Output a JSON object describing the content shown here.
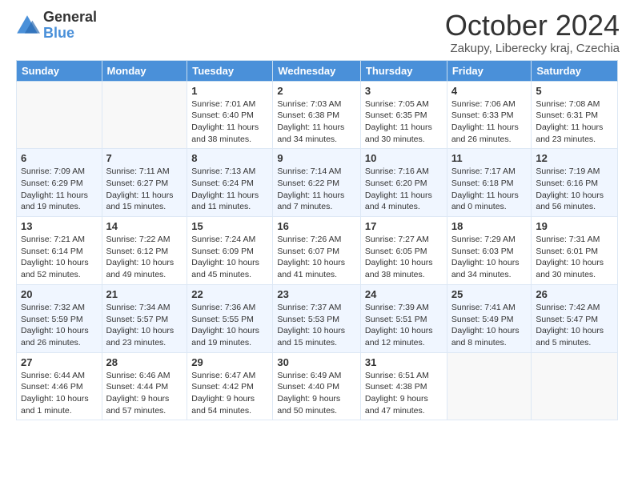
{
  "logo": {
    "general": "General",
    "blue": "Blue"
  },
  "title": "October 2024",
  "location": "Zakupy, Liberecky kraj, Czechia",
  "weekdays": [
    "Sunday",
    "Monday",
    "Tuesday",
    "Wednesday",
    "Thursday",
    "Friday",
    "Saturday"
  ],
  "weeks": [
    [
      {
        "day": "",
        "info": ""
      },
      {
        "day": "",
        "info": ""
      },
      {
        "day": "1",
        "info": "Sunrise: 7:01 AM\nSunset: 6:40 PM\nDaylight: 11 hours and 38 minutes."
      },
      {
        "day": "2",
        "info": "Sunrise: 7:03 AM\nSunset: 6:38 PM\nDaylight: 11 hours and 34 minutes."
      },
      {
        "day": "3",
        "info": "Sunrise: 7:05 AM\nSunset: 6:35 PM\nDaylight: 11 hours and 30 minutes."
      },
      {
        "day": "4",
        "info": "Sunrise: 7:06 AM\nSunset: 6:33 PM\nDaylight: 11 hours and 26 minutes."
      },
      {
        "day": "5",
        "info": "Sunrise: 7:08 AM\nSunset: 6:31 PM\nDaylight: 11 hours and 23 minutes."
      }
    ],
    [
      {
        "day": "6",
        "info": "Sunrise: 7:09 AM\nSunset: 6:29 PM\nDaylight: 11 hours and 19 minutes."
      },
      {
        "day": "7",
        "info": "Sunrise: 7:11 AM\nSunset: 6:27 PM\nDaylight: 11 hours and 15 minutes."
      },
      {
        "day": "8",
        "info": "Sunrise: 7:13 AM\nSunset: 6:24 PM\nDaylight: 11 hours and 11 minutes."
      },
      {
        "day": "9",
        "info": "Sunrise: 7:14 AM\nSunset: 6:22 PM\nDaylight: 11 hours and 7 minutes."
      },
      {
        "day": "10",
        "info": "Sunrise: 7:16 AM\nSunset: 6:20 PM\nDaylight: 11 hours and 4 minutes."
      },
      {
        "day": "11",
        "info": "Sunrise: 7:17 AM\nSunset: 6:18 PM\nDaylight: 11 hours and 0 minutes."
      },
      {
        "day": "12",
        "info": "Sunrise: 7:19 AM\nSunset: 6:16 PM\nDaylight: 10 hours and 56 minutes."
      }
    ],
    [
      {
        "day": "13",
        "info": "Sunrise: 7:21 AM\nSunset: 6:14 PM\nDaylight: 10 hours and 52 minutes."
      },
      {
        "day": "14",
        "info": "Sunrise: 7:22 AM\nSunset: 6:12 PM\nDaylight: 10 hours and 49 minutes."
      },
      {
        "day": "15",
        "info": "Sunrise: 7:24 AM\nSunset: 6:09 PM\nDaylight: 10 hours and 45 minutes."
      },
      {
        "day": "16",
        "info": "Sunrise: 7:26 AM\nSunset: 6:07 PM\nDaylight: 10 hours and 41 minutes."
      },
      {
        "day": "17",
        "info": "Sunrise: 7:27 AM\nSunset: 6:05 PM\nDaylight: 10 hours and 38 minutes."
      },
      {
        "day": "18",
        "info": "Sunrise: 7:29 AM\nSunset: 6:03 PM\nDaylight: 10 hours and 34 minutes."
      },
      {
        "day": "19",
        "info": "Sunrise: 7:31 AM\nSunset: 6:01 PM\nDaylight: 10 hours and 30 minutes."
      }
    ],
    [
      {
        "day": "20",
        "info": "Sunrise: 7:32 AM\nSunset: 5:59 PM\nDaylight: 10 hours and 26 minutes."
      },
      {
        "day": "21",
        "info": "Sunrise: 7:34 AM\nSunset: 5:57 PM\nDaylight: 10 hours and 23 minutes."
      },
      {
        "day": "22",
        "info": "Sunrise: 7:36 AM\nSunset: 5:55 PM\nDaylight: 10 hours and 19 minutes."
      },
      {
        "day": "23",
        "info": "Sunrise: 7:37 AM\nSunset: 5:53 PM\nDaylight: 10 hours and 15 minutes."
      },
      {
        "day": "24",
        "info": "Sunrise: 7:39 AM\nSunset: 5:51 PM\nDaylight: 10 hours and 12 minutes."
      },
      {
        "day": "25",
        "info": "Sunrise: 7:41 AM\nSunset: 5:49 PM\nDaylight: 10 hours and 8 minutes."
      },
      {
        "day": "26",
        "info": "Sunrise: 7:42 AM\nSunset: 5:47 PM\nDaylight: 10 hours and 5 minutes."
      }
    ],
    [
      {
        "day": "27",
        "info": "Sunrise: 6:44 AM\nSunset: 4:46 PM\nDaylight: 10 hours and 1 minute."
      },
      {
        "day": "28",
        "info": "Sunrise: 6:46 AM\nSunset: 4:44 PM\nDaylight: 9 hours and 57 minutes."
      },
      {
        "day": "29",
        "info": "Sunrise: 6:47 AM\nSunset: 4:42 PM\nDaylight: 9 hours and 54 minutes."
      },
      {
        "day": "30",
        "info": "Sunrise: 6:49 AM\nSunset: 4:40 PM\nDaylight: 9 hours and 50 minutes."
      },
      {
        "day": "31",
        "info": "Sunrise: 6:51 AM\nSunset: 4:38 PM\nDaylight: 9 hours and 47 minutes."
      },
      {
        "day": "",
        "info": ""
      },
      {
        "day": "",
        "info": ""
      }
    ]
  ]
}
